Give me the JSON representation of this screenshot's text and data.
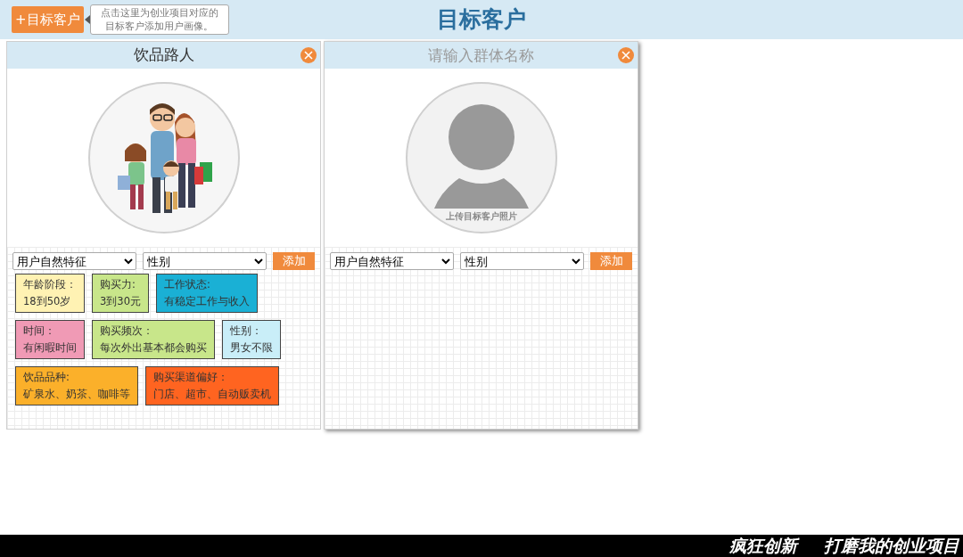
{
  "header": {
    "add_button": "+目标客户",
    "tooltip": "点击这里为创业项目对应的目标客户添加用户画像。",
    "title": "目标客户"
  },
  "cards": [
    {
      "title": "饮品路人",
      "photo": {
        "kind": "illustration"
      },
      "select_1": "用户自然特征",
      "select_2": "性别",
      "add_button": "添加",
      "tags": [
        {
          "label": "年龄阶段：",
          "value": "18到50岁",
          "color": "#fff2b3"
        },
        {
          "label": "购买力:",
          "value": "3到30元",
          "color": "#c8e68a"
        },
        {
          "label": "工作状态:",
          "value": "有稳定工作与收入",
          "color": "#1ab0d5"
        },
        {
          "label": "时间：",
          "value": "有闲暇时间",
          "color": "#f09ab5"
        },
        {
          "label": "购买频次：",
          "value": "每次外出基本都会购买",
          "color": "#c8e68a"
        },
        {
          "label": "性别：",
          "value": "男女不限",
          "color": "#c9eef8"
        },
        {
          "label": "饮品品种:",
          "value": "矿泉水、奶茶、咖啡等",
          "color": "#fbb02a"
        },
        {
          "label": "购买渠道偏好：",
          "value": "门店、超市、自动贩卖机",
          "color": "#ff6420"
        }
      ]
    },
    {
      "title_placeholder": "请输入群体名称",
      "photo": {
        "kind": "placeholder",
        "caption": "上传目标客户照片"
      },
      "select_1": "用户自然特征",
      "select_2": "性别",
      "add_button": "添加"
    }
  ],
  "footer": {
    "left": "疯狂创新",
    "right": "打磨我的创业项目"
  }
}
